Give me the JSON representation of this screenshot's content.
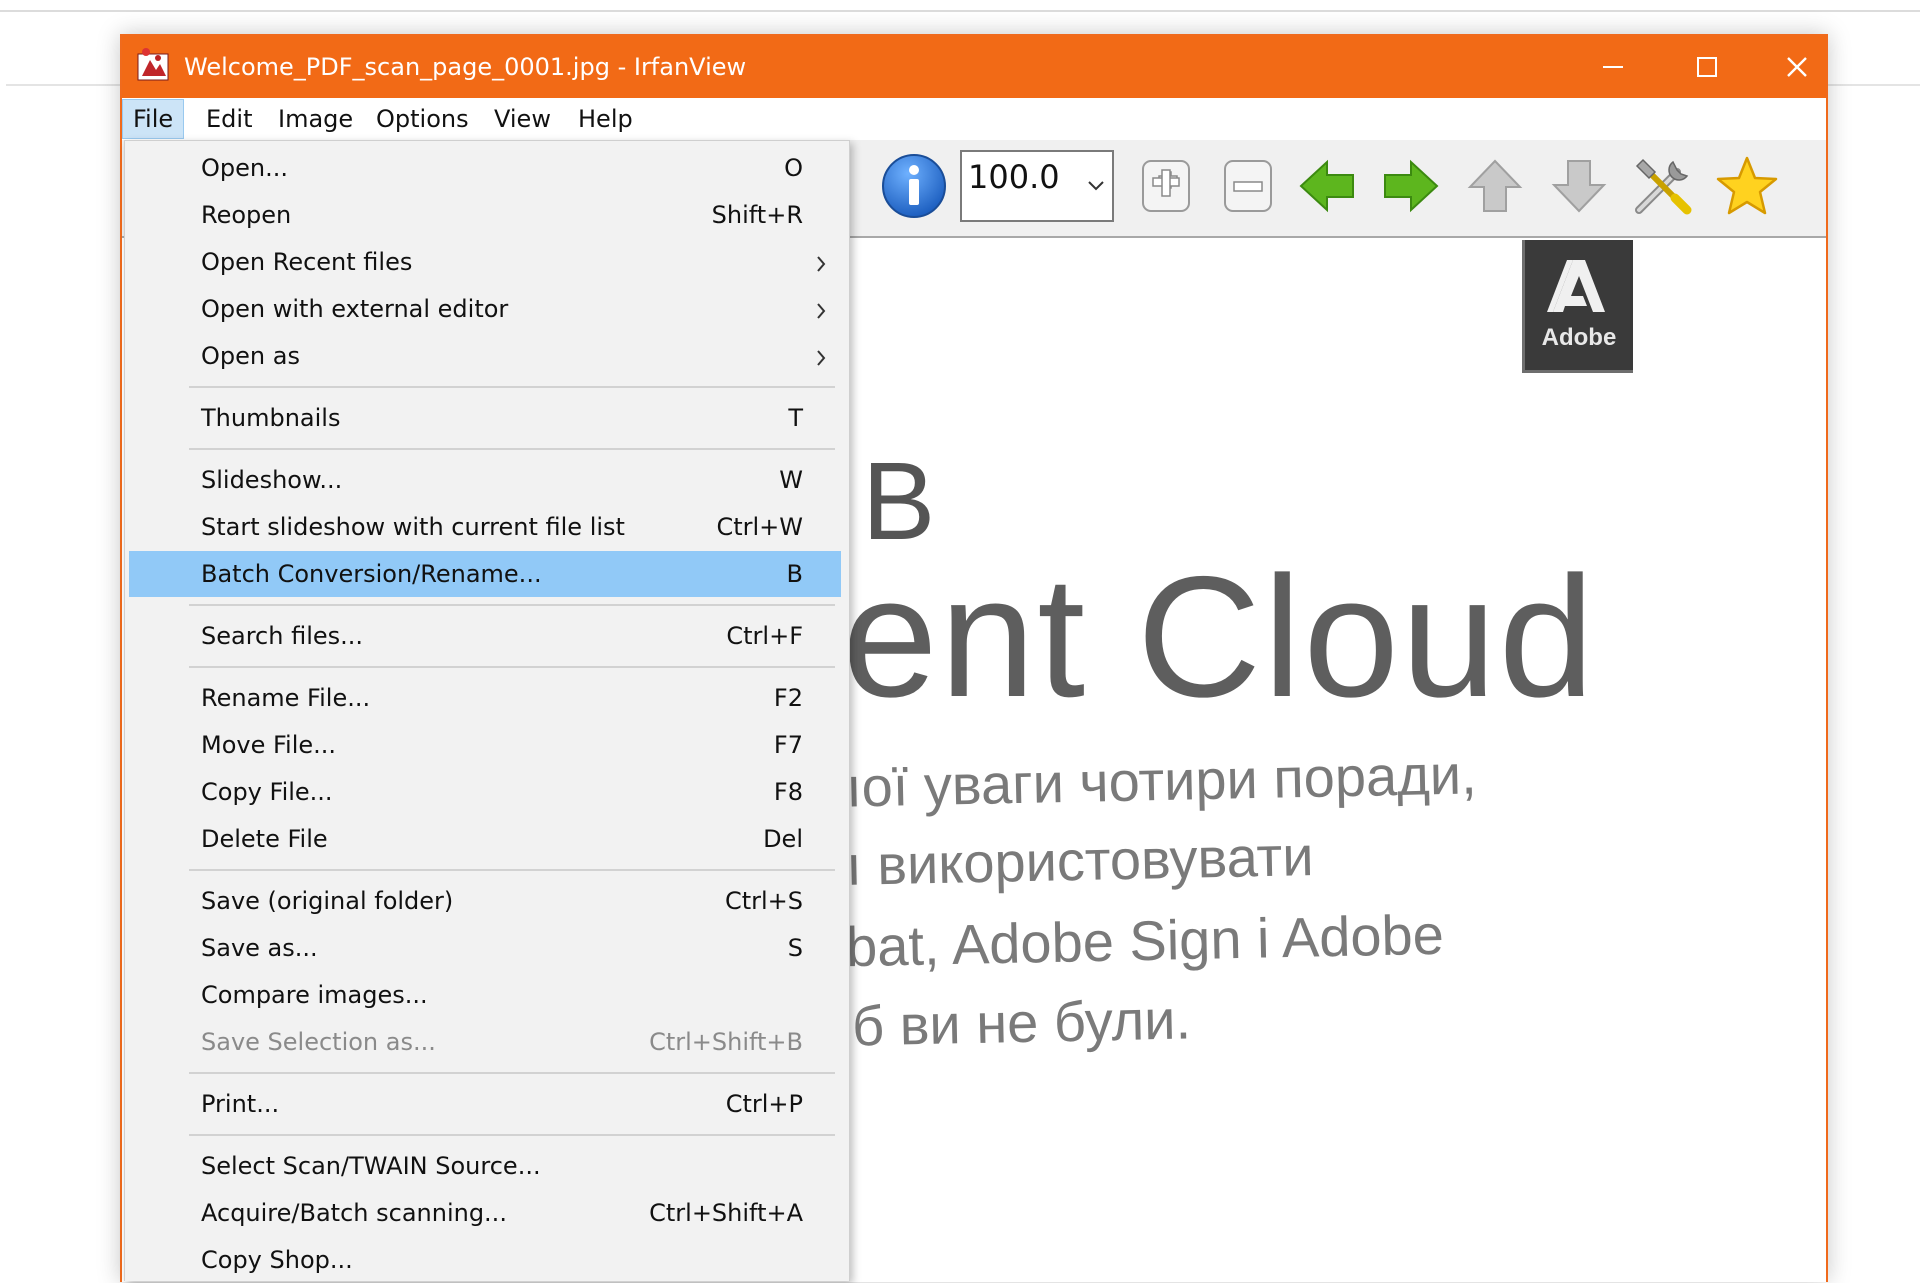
{
  "window": {
    "title": "Welcome_PDF_scan_page_0001.jpg - IrfanView"
  },
  "menubar": {
    "items": [
      {
        "label": "File"
      },
      {
        "label": "Edit"
      },
      {
        "label": "Image"
      },
      {
        "label": "Options"
      },
      {
        "label": "View"
      },
      {
        "label": "Help"
      }
    ]
  },
  "toolbar": {
    "zoom_value": "100.0"
  },
  "document": {
    "badge": "Adobe",
    "line_b": "B",
    "line_cloud": "ent Cloud",
    "line_1": "ıoї уваги чотири поради,",
    "line_2": "ı використовувати",
    "line_3": "bat, Adobe Sign i Adobe",
    "line_4": "б ви не були."
  },
  "file_menu": {
    "items": [
      {
        "label": "Open...",
        "shortcut": "O"
      },
      {
        "label": "Reopen",
        "shortcut": "Shift+R"
      },
      {
        "label": "Open Recent files",
        "shortcut": ""
      },
      {
        "label": "Open with external editor",
        "shortcut": ""
      },
      {
        "label": "Open as",
        "shortcut": ""
      },
      {
        "label": "Thumbnails",
        "shortcut": "T"
      },
      {
        "label": "Slideshow...",
        "shortcut": "W"
      },
      {
        "label": "Start slideshow with current file list",
        "shortcut": "Ctrl+W"
      },
      {
        "label": "Batch Conversion/Rename...",
        "shortcut": "B"
      },
      {
        "label": "Search files...",
        "shortcut": "Ctrl+F"
      },
      {
        "label": "Rename File...",
        "shortcut": "F2"
      },
      {
        "label": "Move File...",
        "shortcut": "F7"
      },
      {
        "label": "Copy File...",
        "shortcut": "F8"
      },
      {
        "label": "Delete File",
        "shortcut": "Del"
      },
      {
        "label": "Save (original folder)",
        "shortcut": "Ctrl+S"
      },
      {
        "label": "Save as...",
        "shortcut": "S"
      },
      {
        "label": "Compare images...",
        "shortcut": ""
      },
      {
        "label": "Save Selection as...",
        "shortcut": "Ctrl+Shift+B"
      },
      {
        "label": "Print...",
        "shortcut": "Ctrl+P"
      },
      {
        "label": "Select Scan/TWAIN Source...",
        "shortcut": ""
      },
      {
        "label": "Acquire/Batch scanning...",
        "shortcut": "Ctrl+Shift+A"
      },
      {
        "label": "Copy Shop...",
        "shortcut": ""
      }
    ],
    "highlighted": "Batch Conversion/Rename...",
    "disabled": "Save Selection as..."
  },
  "colors": {
    "title_bar": "#f26a16",
    "menu_highlight": "#91c9f7",
    "menu_bg": "#f2f2f2"
  },
  "icons": [
    "app-icon",
    "minimize-icon",
    "maximize-icon",
    "close-icon",
    "info-icon",
    "zoom-in-icon",
    "zoom-out-icon",
    "arrow-left-icon",
    "arrow-right-icon",
    "arrow-up-icon",
    "arrow-down-icon",
    "tools-icon",
    "star-icon",
    "chevron-right-icon"
  ]
}
